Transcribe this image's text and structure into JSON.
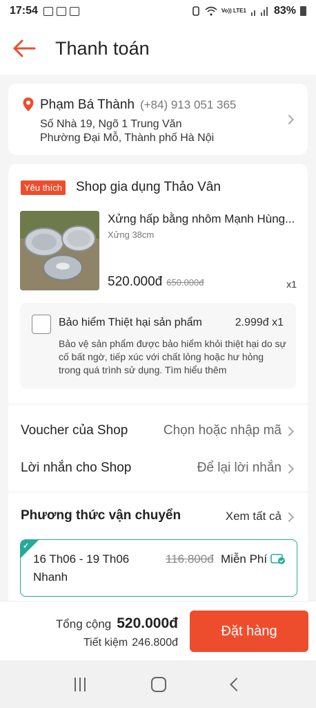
{
  "status_bar": {
    "time": "17:54",
    "network_label": "Vo)) LTE1",
    "battery": "83%"
  },
  "header": {
    "title": "Thanh toán"
  },
  "address": {
    "name": "Phạm Bá Thành",
    "phone": "(+84) 913 051 365",
    "line1": "Số Nhà 19, Ngõ 1 Trung Văn",
    "line2": "Phường Đại Mỗ, Thành phố Hà Nội"
  },
  "shop": {
    "badge": "Yêu thích",
    "name": "Shop gia dụng Thảo Vân"
  },
  "product": {
    "name": "Xửng hấp bằng nhôm Mạnh Hùng...",
    "variant": "Xửng 38cm",
    "price": "520.000đ",
    "old_price": "650.000đ",
    "quantity": "x1"
  },
  "insurance": {
    "title": "Bảo hiểm Thiệt hại sản phẩm",
    "price": "2.999đ x1",
    "description": "Bảo vệ sản phẩm được bảo hiểm khỏi thiệt hại do sự cố bất ngờ, tiếp xúc với chất lỏng hoặc hư hỏng trong quá trình sử dụng. Tìm hiểu thêm"
  },
  "voucher": {
    "label": "Voucher của Shop",
    "value": "Chọn hoặc nhập mã"
  },
  "message": {
    "label": "Lời nhắn cho Shop",
    "value": "Để lại lời nhắn"
  },
  "shipping": {
    "title": "Phương thức vận chuyển",
    "see_all": "Xem tất cả",
    "date_range": "16 Th06 - 19 Th06",
    "speed": "Nhanh",
    "old_fee": "116.800đ",
    "fee": "Miễn Phí",
    "accent": "#26aa99"
  },
  "footer": {
    "total_label": "Tổng cộng",
    "total_value": "520.000đ",
    "saving_label": "Tiết kiệm",
    "saving_value": "246.800đ",
    "order_button": "Đặt hàng"
  },
  "colors": {
    "primary": "#ee4d2d",
    "background": "#f5f5f5"
  }
}
